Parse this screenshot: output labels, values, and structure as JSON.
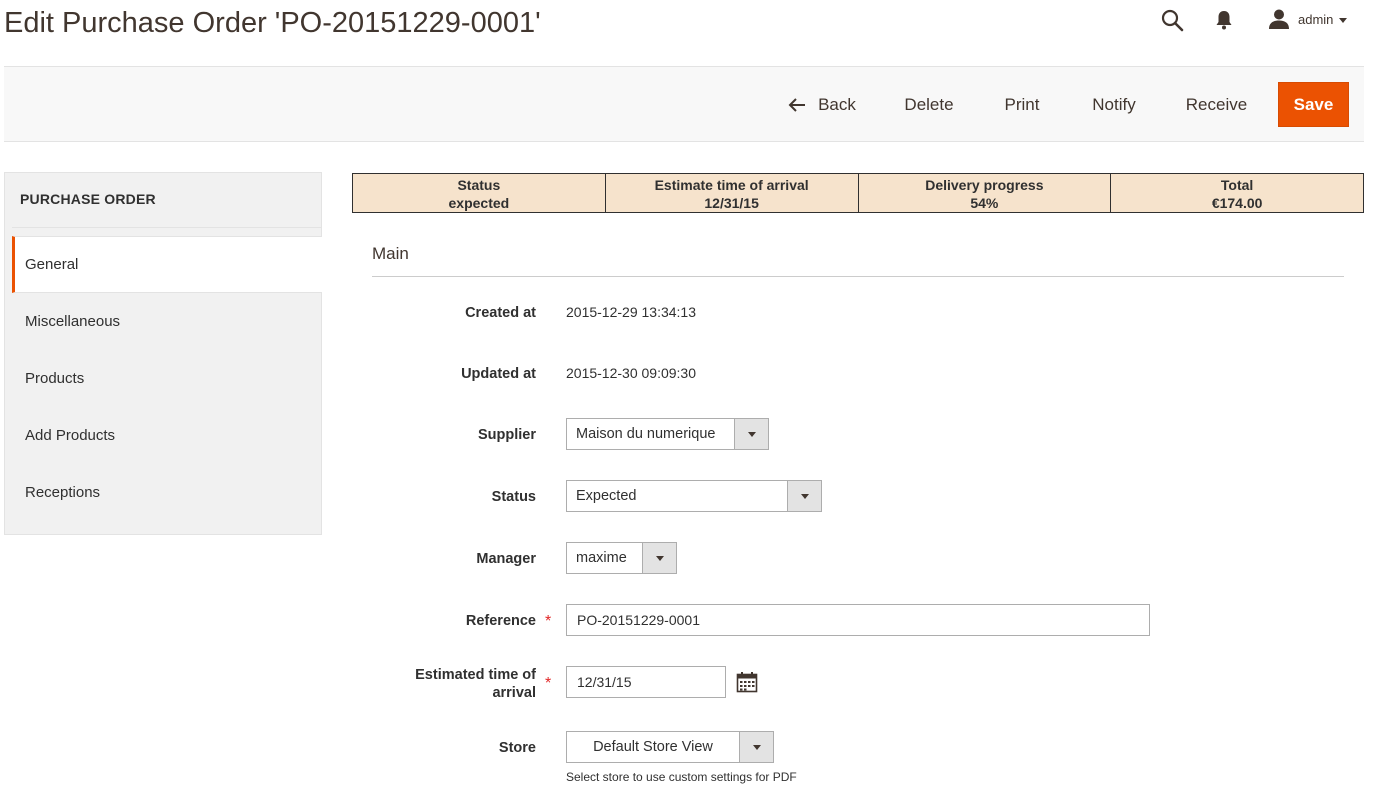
{
  "header": {
    "title": "Edit Purchase Order 'PO-20151229-0001'",
    "user": "admin"
  },
  "toolbar": {
    "back": "Back",
    "delete": "Delete",
    "print": "Print",
    "notify": "Notify",
    "receive": "Receive",
    "save": "Save"
  },
  "sidebar": {
    "title": "PURCHASE ORDER",
    "items": [
      {
        "label": "General",
        "active": true
      },
      {
        "label": "Miscellaneous",
        "active": false
      },
      {
        "label": "Products",
        "active": false
      },
      {
        "label": "Add Products",
        "active": false
      },
      {
        "label": "Receptions",
        "active": false
      }
    ]
  },
  "summary": [
    {
      "label": "Status",
      "value": "expected"
    },
    {
      "label": "Estimate time of arrival",
      "value": "12/31/15"
    },
    {
      "label": "Delivery progress",
      "value": "54%"
    },
    {
      "label": "Total",
      "value": "€174.00"
    }
  ],
  "main": {
    "section_title": "Main",
    "created_at": {
      "label": "Created at",
      "value": "2015-12-29 13:34:13"
    },
    "updated_at": {
      "label": "Updated at",
      "value": "2015-12-30 09:09:30"
    },
    "supplier": {
      "label": "Supplier",
      "value": "Maison du numerique"
    },
    "status": {
      "label": "Status",
      "value": "Expected"
    },
    "manager": {
      "label": "Manager",
      "value": "maxime"
    },
    "reference": {
      "label": "Reference",
      "value": "PO-20151229-0001",
      "required_mark": "*"
    },
    "eta": {
      "label_line1": "Estimated time of",
      "label_line2": "arrival",
      "value": "12/31/15",
      "required_mark": "*"
    },
    "store": {
      "label": "Store",
      "value": "Default Store View",
      "note": "Select store to use custom settings for PDF"
    }
  },
  "colors": {
    "accent": "#eb5202",
    "summary_bg": "#f6e3cc",
    "sidebar_bg": "#f1f1f1"
  },
  "icons": [
    "search-icon",
    "bell-icon",
    "user-icon",
    "arrow-left-icon",
    "calendar-icon",
    "chevron-down-icon"
  ]
}
